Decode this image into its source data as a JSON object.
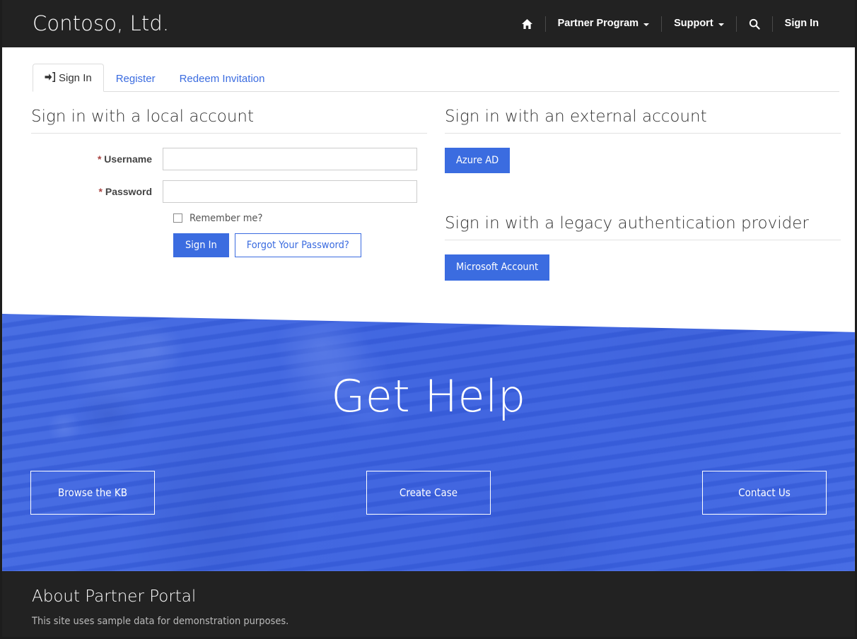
{
  "colors": {
    "header_bg": "#222222",
    "accent_blue": "#3b6ce0",
    "hero_blue": "#3d63e0",
    "link_blue": "#3b6ce0",
    "required_red": "#a94442",
    "footer_bg": "#222222"
  },
  "header": {
    "brand": "Contoso, Ltd.",
    "home_icon": "home-icon",
    "search_icon": "search-icon",
    "nav": [
      {
        "label": "Partner Program",
        "has_caret": true
      },
      {
        "label": "Support",
        "has_caret": true
      }
    ],
    "sign_in": "Sign In"
  },
  "tabs": [
    {
      "label": "Sign In",
      "icon": "sign-in-icon",
      "active": true
    },
    {
      "label": "Register",
      "icon": "",
      "active": false
    },
    {
      "label": "Redeem Invitation",
      "icon": "",
      "active": false
    }
  ],
  "local_account": {
    "heading": "Sign in with a local account",
    "username": {
      "label": "Username",
      "required_marker": "*",
      "value": "",
      "placeholder": ""
    },
    "password": {
      "label": "Password",
      "required_marker": "*",
      "value": "",
      "placeholder": ""
    },
    "remember_me": {
      "label": "Remember me?",
      "checked": false
    },
    "sign_in_button": "Sign In",
    "forgot_password_button": "Forgot Your Password?"
  },
  "external_account": {
    "heading": "Sign in with an external account",
    "providers": [
      {
        "label": "Azure AD"
      }
    ]
  },
  "legacy_account": {
    "heading": "Sign in with a legacy authentication provider",
    "providers": [
      {
        "label": "Microsoft Account"
      }
    ]
  },
  "hero": {
    "title": "Get Help",
    "buttons": [
      {
        "label": "Browse the KB"
      },
      {
        "label": "Create Case"
      },
      {
        "label": "Contact Us"
      }
    ]
  },
  "footer": {
    "title": "About Partner Portal",
    "text": "This site uses sample data for demonstration purposes."
  }
}
